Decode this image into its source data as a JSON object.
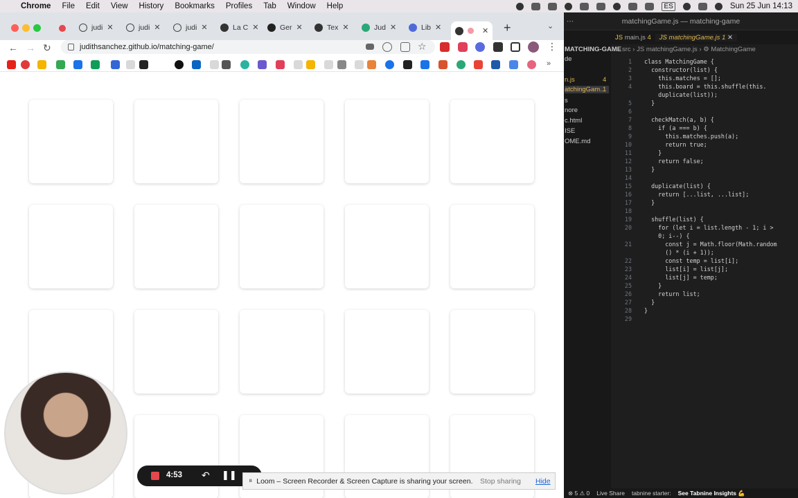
{
  "menubar": {
    "app": "Chrome",
    "items": [
      "File",
      "Edit",
      "View",
      "History",
      "Bookmarks",
      "Profiles",
      "Tab",
      "Window",
      "Help"
    ],
    "input_source": "ES",
    "datetime": "Sun 25 Jun  14:13"
  },
  "browser": {
    "tabs": [
      {
        "label": "judi",
        "icon": "github-icon",
        "color": "#444444"
      },
      {
        "label": "judi",
        "icon": "github-icon",
        "color": "#444444"
      },
      {
        "label": "judi",
        "icon": "github-icon",
        "color": "#444444"
      },
      {
        "label": "La C",
        "icon": "globe-icon",
        "color": "#333333"
      },
      {
        "label": "Ger",
        "icon": "github-icon",
        "color": "#222222"
      },
      {
        "label": "Tex",
        "icon": "globe-icon",
        "color": "#333333"
      },
      {
        "label": "Jud",
        "icon": "leaf-icon",
        "color": "#2aa876"
      },
      {
        "label": "Lib",
        "icon": "gear-icon",
        "color": "#4f6ad8"
      }
    ],
    "url": "judithsanchez.github.io/matching-game/"
  },
  "game": {
    "card_count": 20
  },
  "vscode": {
    "window_title": "matchingGame.js — matching-game",
    "project": "MATCHING-GAME",
    "explorer_items": [
      "de",
      "n.js",
      "atchingGam...",
      "s",
      "nore",
      "c.html",
      "ISE",
      "OME.md"
    ],
    "explorer_badges": [
      "4",
      "1"
    ],
    "tabs": [
      {
        "label": "main.js",
        "badge": "4"
      },
      {
        "label": "matchingGame.js",
        "badge": "1"
      }
    ],
    "breadcrumb": "src  ›  JS matchingGame.js  ›  ⚙ MatchingGame",
    "line_numbers": [
      "1",
      "2",
      "3",
      "4",
      "",
      "5",
      "6",
      "7",
      "8",
      "9",
      "10",
      "11",
      "12",
      "13",
      "14",
      "15",
      "16",
      "17",
      "18",
      "19",
      "20",
      "",
      "21",
      "",
      "22",
      "23",
      "24",
      "25",
      "26",
      "27",
      "28",
      "29"
    ],
    "code_lines": [
      "class MatchingGame {",
      "  constructor(list) {",
      "    this.matches = [];",
      "    this.board = this.shuffle(this.",
      "    duplicate(list));",
      "  }",
      "",
      "  checkMatch(a, b) {",
      "    if (a === b) {",
      "      this.matches.push(a);",
      "      return true;",
      "    }",
      "    return false;",
      "  }",
      "",
      "  duplicate(list) {",
      "    return [...list, ...list];",
      "  }",
      "",
      "  shuffle(list) {",
      "    for (let i = list.length - 1; i >",
      "    0; i--) {",
      "      const j = Math.floor(Math.random",
      "      () * (i + 1));",
      "      const temp = list[i];",
      "      list[i] = list[j];",
      "      list[j] = temp;",
      "    }",
      "    return list;",
      "  }",
      "}",
      ""
    ],
    "status": {
      "problems": "⊗ 5 ⚠ 0",
      "live_share": "Live Share",
      "tabnine": "tabnine starter:",
      "tabnine_insights": "See Tabnine Insights 💪"
    }
  },
  "loom": {
    "timer": "4:53",
    "sharing_message": "Loom – Screen Recorder & Screen Capture is sharing your screen.",
    "stop_label": "Stop sharing",
    "hide_label": "Hide"
  },
  "colors": {
    "accent": "#e5484d",
    "link": "#1a66d9"
  }
}
